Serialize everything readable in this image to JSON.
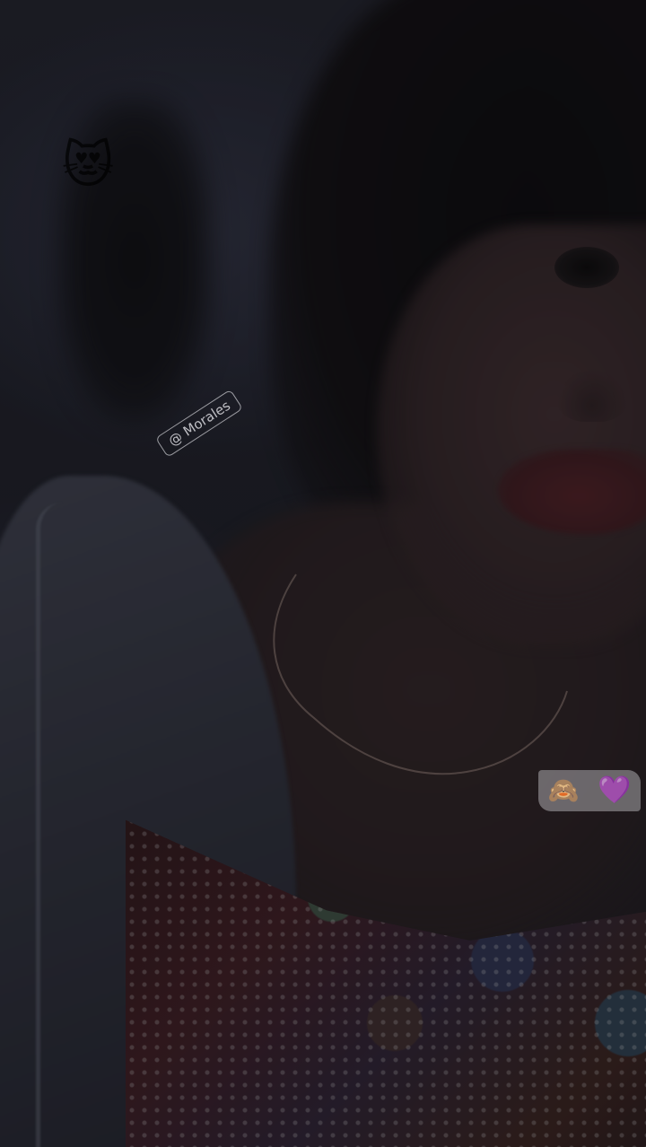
{
  "photo": {
    "description_icon": "selfie-photo"
  },
  "stickers": {
    "handle_text": "@ Morales",
    "cat_emoji": "😻",
    "monkey_emoji": "🙈",
    "heart_emoji": "💜"
  }
}
